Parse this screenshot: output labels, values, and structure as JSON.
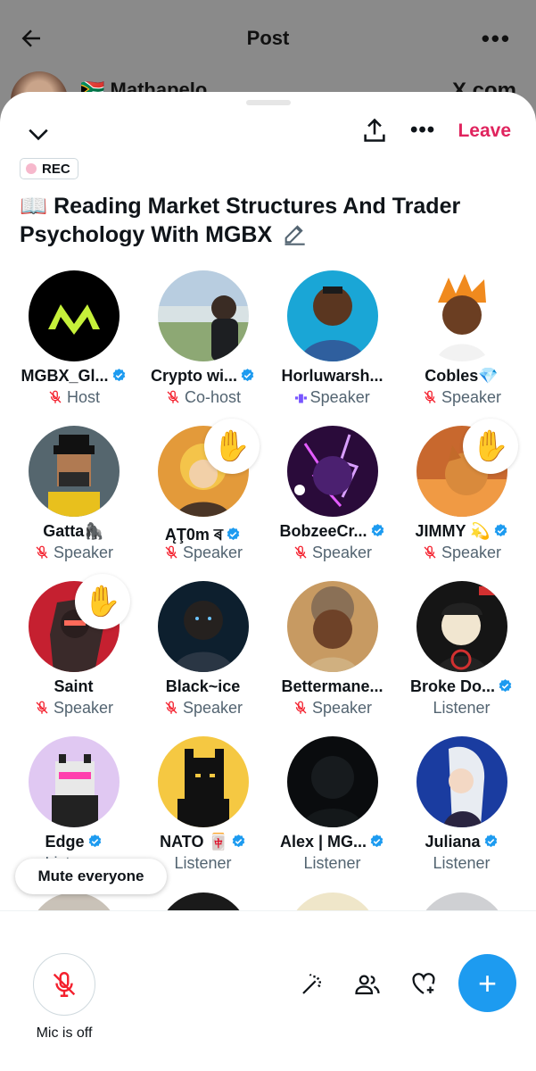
{
  "background_post": {
    "title": "Post",
    "author": "🇿🇦 Mathapelo",
    "source": "X.com"
  },
  "space": {
    "leave_label": "Leave",
    "rec_label": "REC",
    "title": "📖 Reading Market Structures And Trader Psychology With MGBX"
  },
  "participants": [
    {
      "name": "MGBX_Gl...",
      "role": "Host",
      "verified": true,
      "mic": "off"
    },
    {
      "name": "Crypto wi...",
      "role": "Co-host",
      "verified": true,
      "mic": "off"
    },
    {
      "name": "Horluwarsh...",
      "role": "Speaker",
      "verified": false,
      "mic": "talking"
    },
    {
      "name": "Cobles💎",
      "role": "Speaker",
      "verified": false,
      "mic": "off"
    },
    {
      "name": "Gatta🦍",
      "role": "Speaker",
      "verified": false,
      "mic": "off"
    },
    {
      "name": "ĄŢ0m ৰ",
      "role": "Speaker",
      "verified": true,
      "mic": "off",
      "hand_raised": true
    },
    {
      "name": "BobzeeCr...",
      "role": "Speaker",
      "verified": true,
      "mic": "off"
    },
    {
      "name": "JIMMY 💫",
      "role": "Speaker",
      "verified": true,
      "mic": "off",
      "hand_raised": true
    },
    {
      "name": "Saint",
      "role": "Speaker",
      "verified": false,
      "mic": "off",
      "hand_raised": true
    },
    {
      "name": "Black~ice",
      "role": "Speaker",
      "verified": false,
      "mic": "off"
    },
    {
      "name": "Bettermane...",
      "role": "Speaker",
      "verified": false,
      "mic": "off"
    },
    {
      "name": "Broke Do...",
      "role": "Listener",
      "verified": true
    },
    {
      "name": "Edge",
      "role": "Listener",
      "verified": true
    },
    {
      "name": "NATO 🀄",
      "role": "Listener",
      "verified": true
    },
    {
      "name": "Alex | MG...",
      "role": "Listener",
      "verified": true
    },
    {
      "name": "Juliana",
      "role": "Listener",
      "verified": true
    }
  ],
  "controls": {
    "mute_everyone": "Mute everyone",
    "mic_status": "Mic is off"
  },
  "colors": {
    "accent": "#1d9bf0",
    "leave": "#e0245e",
    "muted_icon": "#f4212e",
    "speaking": "#7856ff"
  }
}
